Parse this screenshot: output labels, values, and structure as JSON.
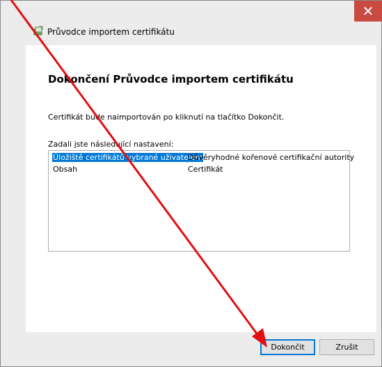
{
  "window": {
    "title": "Průvodce importem certifikátu",
    "close_glyph": "✕"
  },
  "wizard": {
    "heading": "Dokončení Průvodce importem certifikátu",
    "info": "Certifikát bude naimportován po kliknutí na tlačítko Dokončit.",
    "list_label": "Zadali jste následující nastavení:",
    "rows": [
      {
        "setting": "Úložiště certifikátů vybrané uživatelem",
        "value": "Důvěryhodné kořenové certifikační autority",
        "selected": true
      },
      {
        "setting": "Obsah",
        "value": "Certifikát",
        "selected": false
      }
    ]
  },
  "buttons": {
    "finish": "Dokončit",
    "cancel": "Zrušit"
  },
  "colors": {
    "accent": "#0078d7",
    "close": "#c94a40",
    "annotation_arrow": "#e01010"
  },
  "icons": {
    "app": "certificate-wizard-icon"
  }
}
